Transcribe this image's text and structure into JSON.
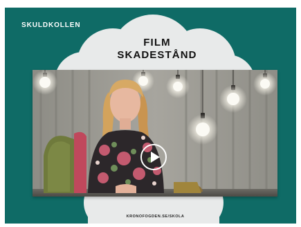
{
  "poster": {
    "brand": "SKULDKOLLEN",
    "title_line1": "FILM",
    "title_line2": "SKADESTÅND",
    "footer_url": "KRONOFOGDEN.SE/SKOLA"
  },
  "icons": {
    "play": "play-icon",
    "lamp": "lightbulb-icon"
  },
  "colors": {
    "background": "#0f6b66",
    "cloud": "#e8eaea",
    "text_dark": "#111111",
    "text_light": "#ffffff"
  }
}
